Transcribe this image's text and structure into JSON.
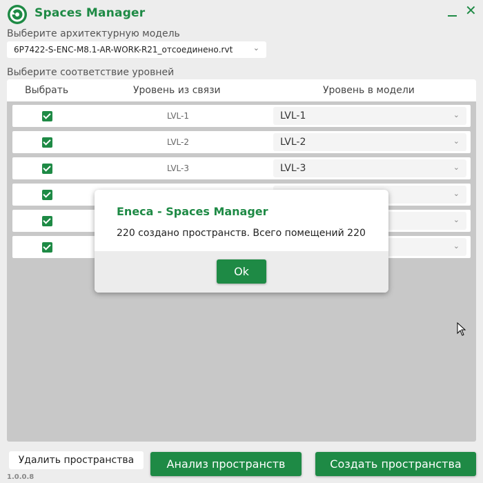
{
  "app": {
    "title": "Spaces Manager",
    "version": "1.0.0.8"
  },
  "model": {
    "label": "Выберите архитектурную модель",
    "selected": "6P7422-S-ENC-M8.1-AR-WORK-R21_отсоединено.rvt"
  },
  "levels": {
    "label": "Выберите соответствие уровней",
    "columns": {
      "select": "Выбрать",
      "linked": "Уровень из связи",
      "model": "Уровень в модели"
    },
    "rows": [
      {
        "checked": true,
        "linked": "LVL-1",
        "model": "LVL-1"
      },
      {
        "checked": true,
        "linked": "LVL-2",
        "model": "LVL-2"
      },
      {
        "checked": true,
        "linked": "LVL-3",
        "model": "LVL-3"
      },
      {
        "checked": true,
        "linked": "",
        "model": ""
      },
      {
        "checked": true,
        "linked": "",
        "model": ""
      },
      {
        "checked": true,
        "linked": "",
        "model": ""
      }
    ]
  },
  "dialog": {
    "title": "Eneca - Spaces Manager",
    "message": "220 создано пространств. Всего помещений 220",
    "ok": "Ok"
  },
  "buttons": {
    "delete": "Удалить пространства",
    "analyze": "Анализ пространств",
    "create": "Создать пространства"
  },
  "colors": {
    "accent": "#1e8a45"
  },
  "icons": {
    "logo": "recycle-logo-icon",
    "minimize": "minimize-icon",
    "close": "close-icon",
    "chevron": "chevron-down-icon",
    "checkbox": "checkmark-icon",
    "cursor": "mouse-cursor-icon"
  }
}
